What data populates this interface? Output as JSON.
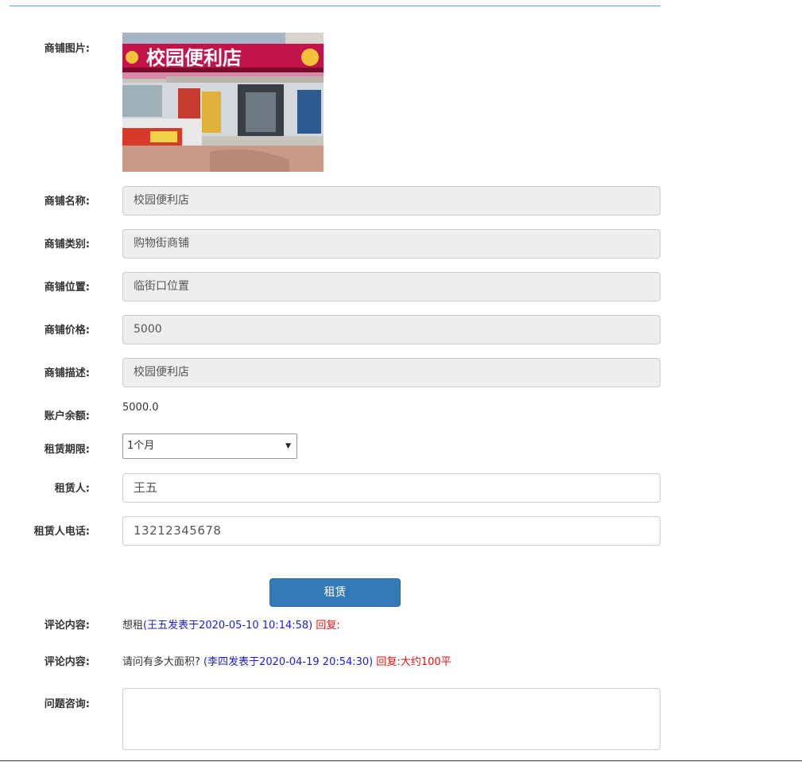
{
  "labels": {
    "image": "商铺图片:",
    "name": "商铺名称:",
    "category": "商铺类别:",
    "location": "商铺位置:",
    "price": "商铺价格:",
    "description": "商铺描述:",
    "balance": "账户余额:",
    "period": "租赁期限:",
    "tenant": "租赁人:",
    "phone": "租赁人电话:",
    "comment": "评论内容:",
    "inquiry": "问题咨询:"
  },
  "shop": {
    "sign_text": "校园便利店",
    "name": "校园便利店",
    "category": "购物街商铺",
    "location": "临街口位置",
    "price": "5000",
    "description": "校园便利店"
  },
  "account": {
    "balance": "5000.0"
  },
  "form": {
    "period_selected": "1个月",
    "tenant": "王五",
    "phone": "13212345678",
    "submit_label": "租赁"
  },
  "comments": [
    {
      "text": "想租",
      "meta": "(王五发表于2020-05-10 10:14:58)",
      "reply_label": "回复:",
      "reply": ""
    },
    {
      "text": "请问有多大面积?",
      "meta": "(李四发表于2020-04-19 20:54:30)",
      "reply_label": "回复:",
      "reply": "大约100平"
    }
  ],
  "colors": {
    "accent": "#337ab7",
    "comment_meta": "#1c1cd6",
    "comment_reply": "#e01010",
    "readonly_bg": "#eeeeee"
  }
}
